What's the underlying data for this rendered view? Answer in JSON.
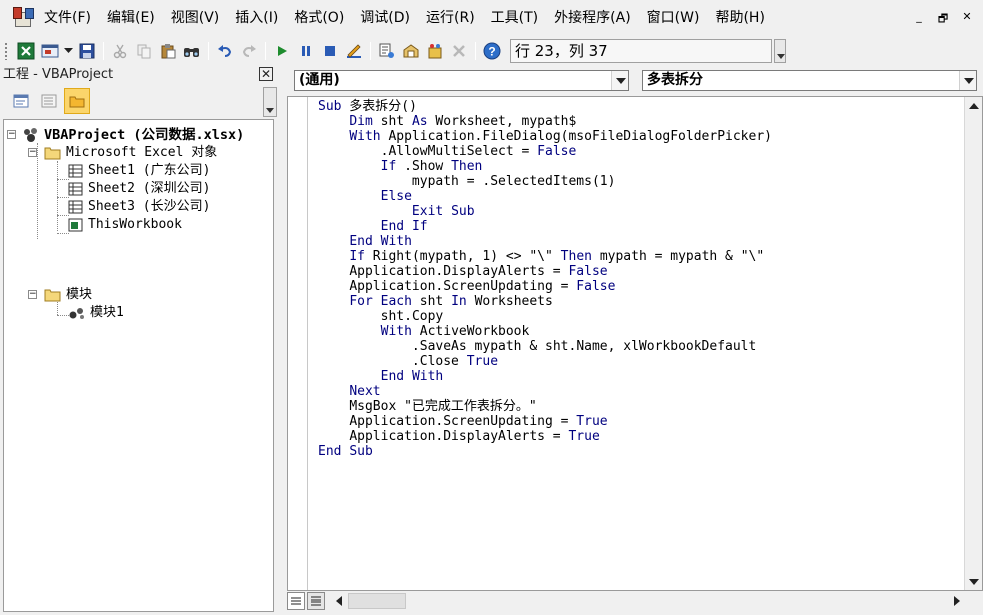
{
  "menubar": {
    "items": [
      {
        "label": "文件(F)",
        "name": "menu-file"
      },
      {
        "label": "编辑(E)",
        "name": "menu-edit"
      },
      {
        "label": "视图(V)",
        "name": "menu-view"
      },
      {
        "label": "插入(I)",
        "name": "menu-insert"
      },
      {
        "label": "格式(O)",
        "name": "menu-format"
      },
      {
        "label": "调试(D)",
        "name": "menu-debug"
      },
      {
        "label": "运行(R)",
        "name": "menu-run"
      },
      {
        "label": "工具(T)",
        "name": "menu-tools"
      },
      {
        "label": "外接程序(A)",
        "name": "menu-addins"
      },
      {
        "label": "窗口(W)",
        "name": "menu-window"
      },
      {
        "label": "帮助(H)",
        "name": "menu-help"
      }
    ],
    "window_controls": [
      "_",
      "🗗",
      "✕"
    ]
  },
  "toolbar": {
    "position_text": "行 23，列 37"
  },
  "project": {
    "title": "工程 - VBAProject",
    "close": "✕",
    "nodes": {
      "root": "VBAProject (公司数据.xlsx)",
      "excel_objects": "Microsoft Excel 对象",
      "sheet1": "Sheet1 (广东公司)",
      "sheet2": "Sheet2 (深圳公司)",
      "sheet3": "Sheet3 (长沙公司)",
      "thisworkbook": "ThisWorkbook",
      "modules": "模块",
      "module1": "模块1"
    }
  },
  "code_window": {
    "object_combo": "(通用)",
    "procedure_combo": "多表拆分",
    "lines": [
      "Sub 多表拆分()",
      "    Dim sht As Worksheet, mypath$",
      "    With Application.FileDialog(msoFileDialogFolderPicker)",
      "        .AllowMultiSelect = False",
      "        If .Show Then",
      "            mypath = .SelectedItems(1)",
      "        Else",
      "            Exit Sub",
      "        End If",
      "    End With",
      "    If Right(mypath, 1) <> \"\\\" Then mypath = mypath & \"\\\"",
      "    Application.DisplayAlerts = False",
      "    Application.ScreenUpdating = False",
      "    For Each sht In Worksheets",
      "        sht.Copy",
      "        With ActiveWorkbook",
      "            .SaveAs mypath & sht.Name, xlWorkbookDefault",
      "            .Close True",
      "        End With",
      "    Next",
      "    MsgBox \"已完成工作表拆分。\"",
      "    Application.ScreenUpdating = True",
      "    Application.DisplayAlerts = True",
      "End Sub"
    ]
  }
}
